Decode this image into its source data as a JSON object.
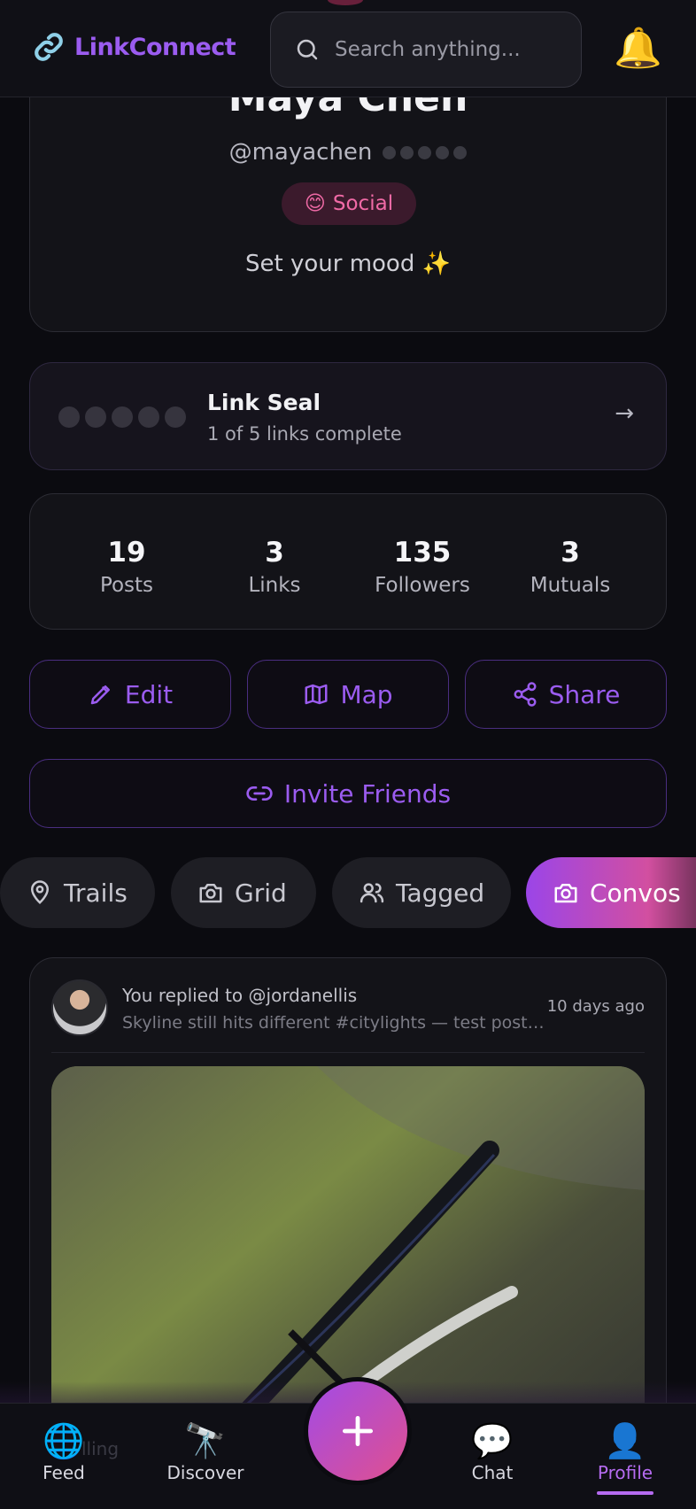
{
  "header": {
    "app_name": "LinkConnect",
    "search_placeholder": "Search anything...",
    "bell_icon": "🔔"
  },
  "profile": {
    "name": "Maya Chen",
    "handle": "@mayachen",
    "mood_badge_emoji": "😊",
    "mood_badge_label": "Social",
    "mood_prompt": "Set your mood ✨"
  },
  "link_seal": {
    "title": "Link Seal",
    "subtitle": "1 of 5 links complete",
    "arrow": "→"
  },
  "stats": [
    {
      "value": "19",
      "label": "Posts"
    },
    {
      "value": "3",
      "label": "Links"
    },
    {
      "value": "135",
      "label": "Followers"
    },
    {
      "value": "3",
      "label": "Mutuals"
    }
  ],
  "actions": {
    "edit": "Edit",
    "map": "Map",
    "share": "Share",
    "invite": "Invite Friends"
  },
  "tabs": [
    {
      "label": "Trails"
    },
    {
      "label": "Grid"
    },
    {
      "label": "Tagged"
    },
    {
      "label": "Convos",
      "active": true
    }
  ],
  "post": {
    "reply_line": "You replied to @jordanellis",
    "snippet": "Skyline still hits different #citylights — test post ...",
    "time": "10 days ago"
  },
  "bottom_nav": {
    "feed": {
      "icon": "🌐",
      "label": "Feed"
    },
    "discover": {
      "icon": "🔭",
      "label": "Discover"
    },
    "chat": {
      "icon": "💬",
      "label": "Chat"
    },
    "profile": {
      "icon": "👤",
      "label": "Profile"
    },
    "faded_text": "lling"
  },
  "colors": {
    "accent": "#9b5cf0",
    "pink": "#e0508f",
    "background": "#0b0b10"
  }
}
